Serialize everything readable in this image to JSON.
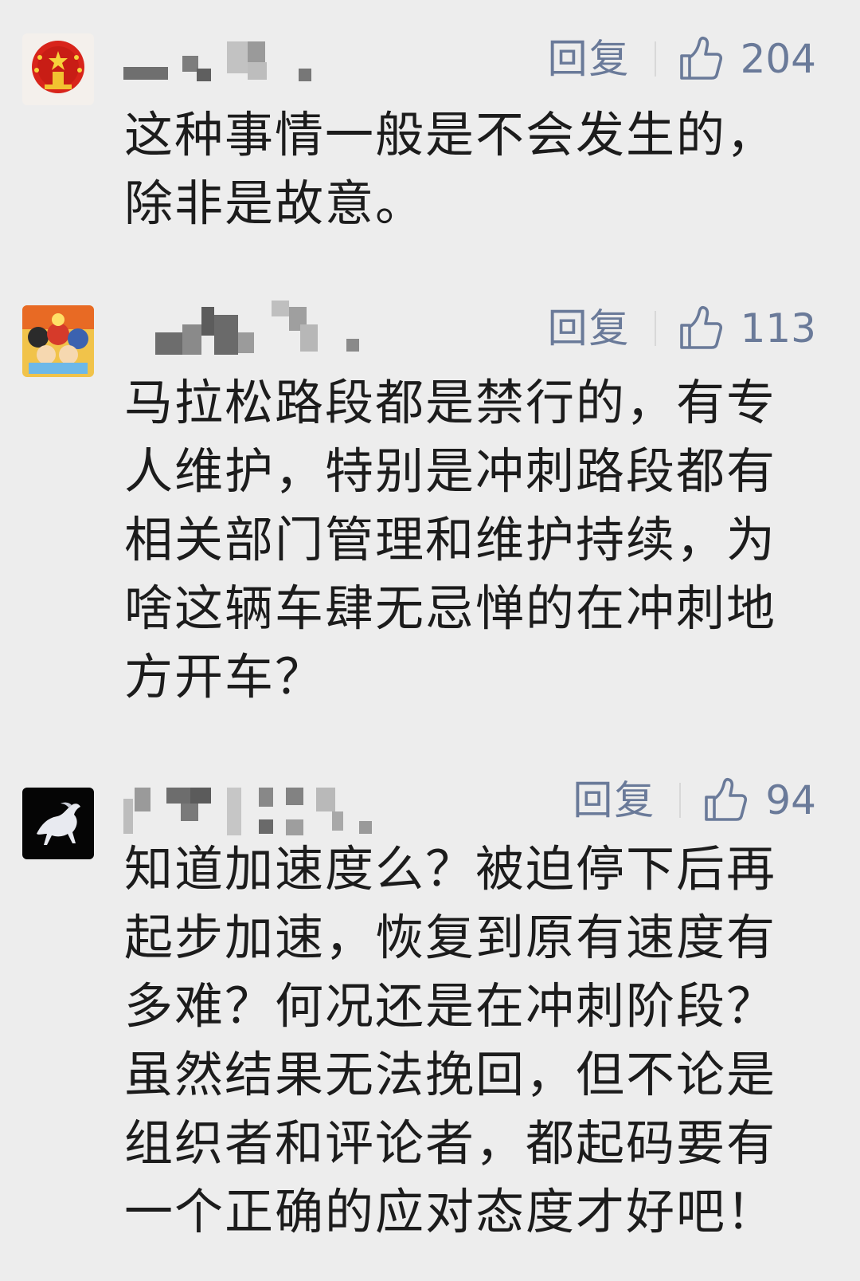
{
  "comments": [
    {
      "avatar": "flag-emblem-avatar",
      "reply_label": "回复",
      "like_icon": "thumbs-up-icon",
      "like_count": "204",
      "lines": [
        "这种事情一般是不会发生的，",
        "除非是故意。"
      ]
    },
    {
      "avatar": "anime-group-avatar",
      "reply_label": "回复",
      "like_icon": "thumbs-up-icon",
      "like_count": "113",
      "lines": [
        "马拉松路段都是禁行的，有专",
        "人维护，特别是冲刺路段都有",
        "相关部门管理和维护持续，为",
        "啥这辆车肆无忌惮的在冲刺地",
        "方开车？"
      ]
    },
    {
      "avatar": "white-horse-avatar",
      "reply_label": "回复",
      "like_icon": "thumbs-up-icon",
      "like_count": "94",
      "lines": [
        "知道加速度么？被迫停下后再",
        "起步加速，恢复到原有速度有",
        "多难？何况还是在冲刺阶段？",
        "虽然结果无法挽回，但不论是",
        "组织者和评论者，都起码要有",
        "一个正确的应对态度才好吧！"
      ]
    }
  ],
  "colors": {
    "background": "#ededed",
    "action_text": "#6a7a99",
    "body_text": "#1c1c1c"
  }
}
